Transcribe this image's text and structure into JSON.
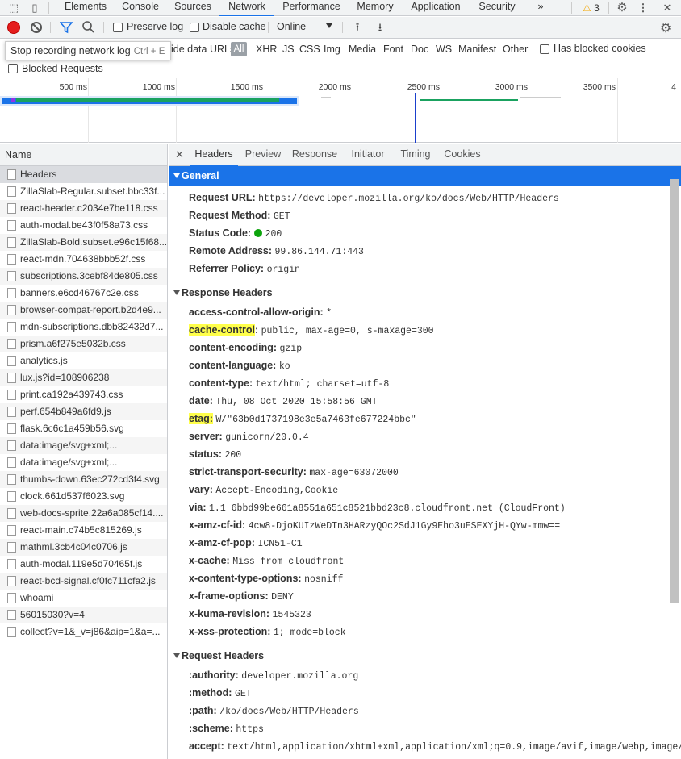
{
  "toptabs": [
    "Elements",
    "Console",
    "Sources",
    "Network",
    "Performance",
    "Memory",
    "Application",
    "Security"
  ],
  "more_tabs": "»",
  "warnings_count": "3",
  "toolbar": {
    "preserve_log": "Preserve log",
    "disable_cache": "Disable cache",
    "throttle": "Online"
  },
  "tooltip": {
    "text": "Stop recording network log",
    "shortcut": "Ctrl + E"
  },
  "filter": {
    "hide_data_urls": "ide data URLs",
    "all": "All",
    "types": [
      "XHR",
      "JS",
      "CSS",
      "Img",
      "Media",
      "Font",
      "Doc",
      "WS",
      "Manifest",
      "Other"
    ],
    "has_blocked_cookies": "Has blocked cookies",
    "blocked_requests": "Blocked Requests"
  },
  "timeline": {
    "ticks": [
      "500 ms",
      "1000 ms",
      "1500 ms",
      "2000 ms",
      "2500 ms",
      "3000 ms",
      "3500 ms",
      "4"
    ]
  },
  "colors": {
    "accent": "#1a73e8",
    "record": "#e51d1d",
    "highlight": "#ffff4a",
    "status_ok": "#0ca40c"
  },
  "requests": {
    "header": "Name",
    "items": [
      "Headers",
      "ZillaSlab-Regular.subset.bbc33f...",
      "react-header.c2034e7be118.css",
      "auth-modal.be43f0f58a73.css",
      "ZillaSlab-Bold.subset.e96c15f68...",
      "react-mdn.704638bbb52f.css",
      "subscriptions.3cebf84de805.css",
      "banners.e6cd46767c2e.css",
      "browser-compat-report.b2d4e9...",
      "mdn-subscriptions.dbb82432d7...",
      "prism.a6f275e5032b.css",
      "analytics.js",
      "lux.js?id=108906238",
      "print.ca192a439743.css",
      "perf.654b849a6fd9.js",
      "flask.6c6c1a459b56.svg",
      "data:image/svg+xml;...",
      "data:image/svg+xml;...",
      "thumbs-down.63ec272cd3f4.svg",
      "clock.661d537f6023.svg",
      "web-docs-sprite.22a6a085cf14....",
      "react-main.c74b5c815269.js",
      "mathml.3cb4c04c0706.js",
      "auth-modal.119e5d70465f.js",
      "react-bcd-signal.cf0fc711cfa2.js",
      "whoami",
      "56015030?v=4",
      "collect?v=1&_v=j86&aip=1&a=..."
    ]
  },
  "detail_tabs": [
    "Headers",
    "Preview",
    "Response",
    "Initiator",
    "Timing",
    "Cookies"
  ],
  "general": {
    "title": "General",
    "rows": [
      {
        "k": "Request URL:",
        "v": "https://developer.mozilla.org/ko/docs/Web/HTTP/Headers"
      },
      {
        "k": "Request Method:",
        "v": "GET"
      },
      {
        "k": "Status Code:",
        "v": "200"
      },
      {
        "k": "Remote Address:",
        "v": "99.86.144.71:443"
      },
      {
        "k": "Referrer Policy:",
        "v": "origin"
      }
    ]
  },
  "response_headers": {
    "title": "Response Headers",
    "rows": [
      {
        "k": "access-control-allow-origin:",
        "v": "*"
      },
      {
        "k": "cache-control",
        "v": "public, max-age=0, s-maxage=300",
        "hl": true
      },
      {
        "k": "content-encoding:",
        "v": "gzip"
      },
      {
        "k": "content-language:",
        "v": "ko"
      },
      {
        "k": "content-type:",
        "v": "text/html; charset=utf-8"
      },
      {
        "k": "date:",
        "v": "Thu, 08 Oct 2020 15:58:56 GMT"
      },
      {
        "k": "etag:",
        "v": "W/\"63b0d1737198e3e5a7463fe677224bbc\"",
        "hl": true
      },
      {
        "k": "server:",
        "v": "gunicorn/20.0.4"
      },
      {
        "k": "status:",
        "v": "200"
      },
      {
        "k": "strict-transport-security:",
        "v": "max-age=63072000"
      },
      {
        "k": "vary:",
        "v": "Accept-Encoding,Cookie"
      },
      {
        "k": "via:",
        "v": "1.1 6bbd99be661a8551a651c8521bbd23c8.cloudfront.net (CloudFront)"
      },
      {
        "k": "x-amz-cf-id:",
        "v": "4cw8-DjoKUIzWeDTn3HARzyQOc2SdJ1Gy9Eho3uESEXYjH-QYw-mmw=="
      },
      {
        "k": "x-amz-cf-pop:",
        "v": "ICN51-C1"
      },
      {
        "k": "x-cache:",
        "v": "Miss from cloudfront"
      },
      {
        "k": "x-content-type-options:",
        "v": "nosniff"
      },
      {
        "k": "x-frame-options:",
        "v": "DENY"
      },
      {
        "k": "x-kuma-revision:",
        "v": "1545323"
      },
      {
        "k": "x-xss-protection:",
        "v": "1; mode=block"
      }
    ]
  },
  "request_headers": {
    "title": "Request Headers",
    "rows": [
      {
        "k": ":authority:",
        "v": "developer.mozilla.org"
      },
      {
        "k": ":method:",
        "v": "GET"
      },
      {
        "k": ":path:",
        "v": "/ko/docs/Web/HTTP/Headers"
      },
      {
        "k": ":scheme:",
        "v": "https"
      },
      {
        "k": "accept:",
        "v": "text/html,application/xhtml+xml,application/xml;q=0.9,image/avif,image/webp,image/"
      }
    ]
  }
}
